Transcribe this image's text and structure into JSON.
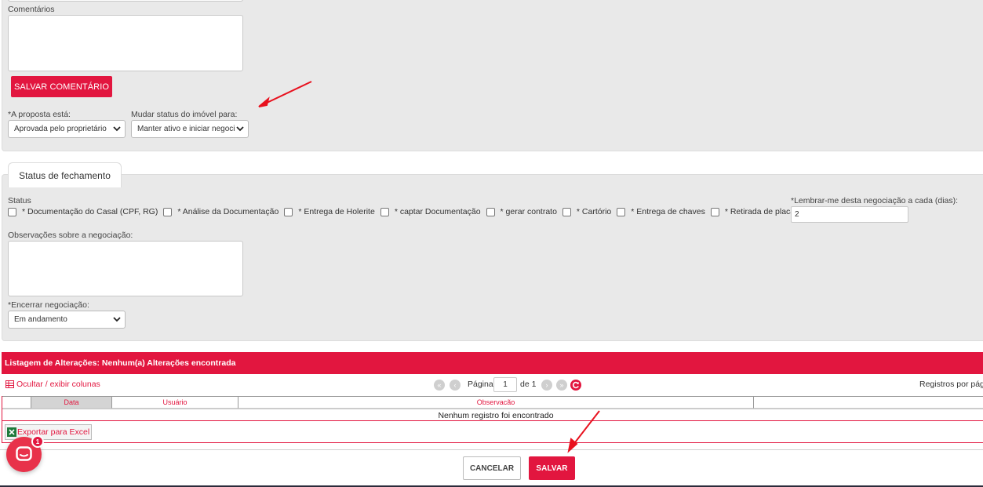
{
  "comments": {
    "label": "Comentários",
    "save_button": "SALVAR COMENTÁRIO"
  },
  "proposal": {
    "label": "*A proposta está:",
    "selected": "Aprovada pelo proprietário"
  },
  "property_status": {
    "label": "Mudar status do imóvel para:",
    "selected": "Manter ativo e iniciar negoci"
  },
  "closing_tab": {
    "label": "Status de fechamento"
  },
  "status": {
    "label": "Status",
    "items": [
      "* Documentação do Casal (CPF, RG)",
      "* Análise da Documentação",
      "* Entrega de Holerite",
      "* captar Documentação",
      "* gerar contrato",
      "* Cartório",
      "* Entrega de chaves",
      "* Retirada de placa"
    ]
  },
  "reminder": {
    "label": "*Lembrar-me desta negociação a cada (dias):",
    "value": "2"
  },
  "observations": {
    "label": "Observações sobre a negociação:"
  },
  "close_negotiation": {
    "label": "*Encerrar negociação:",
    "selected": "Em andamento"
  },
  "changes_grid": {
    "title": "Listagem de Alterações: Nenhum(a) Alterações encontrada",
    "toggle_columns": "Ocultar / exibir colunas",
    "page_label": "Página",
    "page_value": "1",
    "page_of": "de 1",
    "per_page_label": "Registros por pági",
    "columns": [
      "Data",
      "Usuário",
      "Observacão"
    ],
    "empty_message": "Nenhum registro foi encontrado",
    "export_label": "Exportar para Excel"
  },
  "footer": {
    "cancel": "CANCELAR",
    "save": "SALVAR"
  },
  "chat": {
    "badge": "1"
  },
  "colors": {
    "accent": "#e2163f",
    "panel": "#e9e9e9"
  }
}
